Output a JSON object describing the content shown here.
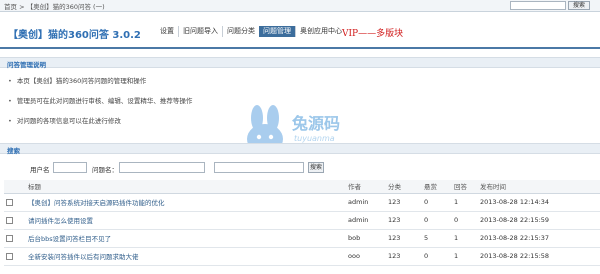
{
  "topbar": {
    "breadcrumb": "首页 > 【奥创】猫的360问答 (一)",
    "search_button": "搜索"
  },
  "header": {
    "app_title": "【奥创】猫的360问答 3.0.2",
    "nav": [
      "设置",
      "旧问题导入",
      "问题分类",
      "问题管理",
      "奥创应用中心"
    ],
    "active_tab": 3,
    "vip": "VIP——多版块"
  },
  "notes_section": {
    "title": "问答管理说明",
    "items": [
      "本页【奥创】猫的360问答问题的管理和操作",
      "管理员可在此对问题进行审核、编辑、设置精华、推荐等操作",
      "对问题的各项信息可以在此进行修改"
    ]
  },
  "watermark": {
    "text": "兔源码",
    "sub": "tuyuanma"
  },
  "search_section": {
    "title": "搜索",
    "username_label": "用户名",
    "keyword_label": "问题名：",
    "submit": "搜索"
  },
  "table": {
    "columns": [
      "标题",
      "作者",
      "分类",
      "悬赏",
      "回答",
      "发布时间"
    ],
    "rows": [
      {
        "title": "【奥创】问答系统对接天启源码插件功能的优化",
        "author": "admin",
        "category": "123",
        "reward": "0",
        "answers": "1",
        "time": "2013-08-28 12:14:34"
      },
      {
        "title": "请问插件怎么使用设置",
        "author": "admin",
        "category": "123",
        "reward": "0",
        "answers": "0",
        "time": "2013-08-28 22:15:59"
      },
      {
        "title": "后台bbs设置问答栏目不见了",
        "author": "bob",
        "category": "123",
        "reward": "5",
        "answers": "1",
        "time": "2013-08-28 22:15:37"
      },
      {
        "title": "全新安装问答插件以后有问题求助大佬",
        "author": "ooo",
        "category": "123",
        "reward": "0",
        "answers": "1",
        "time": "2013-08-28 22:15:58"
      }
    ]
  }
}
